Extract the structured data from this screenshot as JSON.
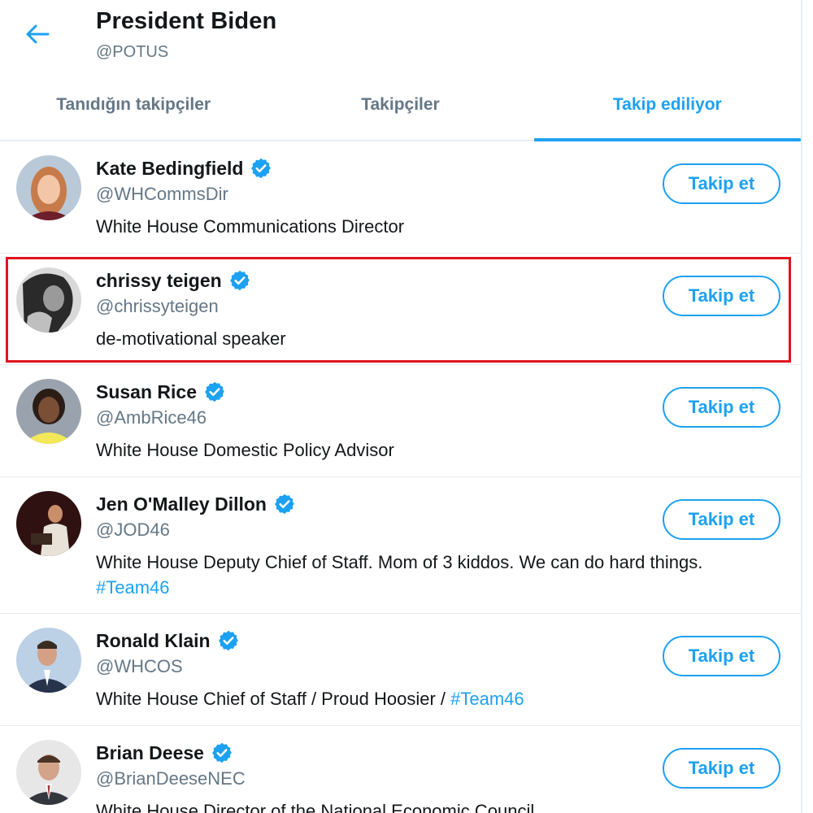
{
  "header": {
    "title": "President Biden",
    "handle": "@POTUS",
    "back_icon": "arrow-left-icon"
  },
  "tabs": [
    {
      "label": "Tanıdığın takipçiler",
      "active": false
    },
    {
      "label": "Takipçiler",
      "active": false
    },
    {
      "label": "Takip ediliyor",
      "active": true
    }
  ],
  "colors": {
    "accent": "#1da1f2",
    "text": "#14171a",
    "secondary_text": "#657786",
    "divider": "#e6ecf0",
    "highlight": "#e0141e"
  },
  "users": [
    {
      "name": "Kate Bedingfield",
      "handle": "@WHCommsDir",
      "verified": true,
      "bio": "White House Communications Director",
      "follow_label": "Takip et"
    },
    {
      "name": "chrissy teigen",
      "handle": "@chrissyteigen",
      "verified": true,
      "bio": "de-motivational speaker",
      "follow_label": "Takip et",
      "highlighted": true
    },
    {
      "name": "Susan Rice",
      "handle": "@AmbRice46",
      "verified": true,
      "bio": "White House Domestic Policy Advisor",
      "follow_label": "Takip et"
    },
    {
      "name": "Jen O'Malley Dillon",
      "handle": "@JOD46",
      "verified": true,
      "bio": "White House Deputy Chief of Staff. Mom of 3 kiddos. We can do hard things.",
      "bio_hashtag": "#Team46",
      "follow_label": "Takip et"
    },
    {
      "name": "Ronald Klain",
      "handle": "@WHCOS",
      "verified": true,
      "bio": "White House Chief of Staff / Proud Hoosier / ",
      "bio_hashtag": "#Team46",
      "follow_label": "Takip et"
    },
    {
      "name": "Brian Deese",
      "handle": "@BrianDeeseNEC",
      "verified": true,
      "bio": "White House Director of the National Economic Council",
      "follow_label": "Takip et"
    }
  ]
}
